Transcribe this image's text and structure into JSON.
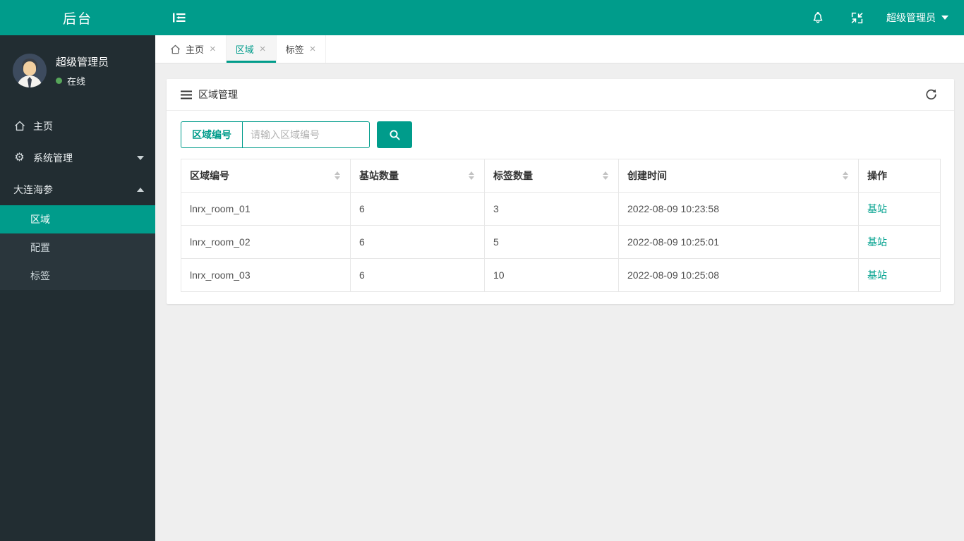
{
  "colors": {
    "accent": "#009c8b",
    "sidebar_bg": "#222d32",
    "submenu_bg": "#2a363c",
    "status_green": "#57a65a"
  },
  "header": {
    "logo": "后台",
    "user_menu_label": "超级管理员",
    "icons": [
      "sidebar-toggle",
      "notifications-bell",
      "exit-fullscreen",
      "user-caret"
    ]
  },
  "sidebar": {
    "user": {
      "name": "超级管理员",
      "status": "在线"
    },
    "menu": [
      {
        "label": "主页",
        "icon": "home"
      },
      {
        "label": "系统管理",
        "icon": "gear",
        "caret": "down"
      },
      {
        "label": "大连海参",
        "caret": "up",
        "expanded": true
      }
    ],
    "submenu": [
      {
        "label": "区域",
        "active": true
      },
      {
        "label": "配置",
        "active": false
      },
      {
        "label": "标签",
        "active": false
      }
    ]
  },
  "tabs": [
    {
      "label": "主页",
      "icon": "home",
      "active": false
    },
    {
      "label": "区域",
      "active": true
    },
    {
      "label": "标签",
      "active": false
    }
  ],
  "panel": {
    "title": "区域管理",
    "search": {
      "field_label": "区域编号",
      "placeholder": "请输入区域编号",
      "button_icon": "magnifier"
    },
    "refresh_icon": "refresh"
  },
  "table": {
    "columns": [
      {
        "label": "区域编号",
        "sortable": true
      },
      {
        "label": "基站数量",
        "sortable": true
      },
      {
        "label": "标签数量",
        "sortable": true
      },
      {
        "label": "创建时间",
        "sortable": true
      },
      {
        "label": "操作",
        "sortable": false
      }
    ],
    "rows": [
      {
        "area_id": "lnrx_room_01",
        "stations": "6",
        "tags": "3",
        "created": "2022-08-09 10:23:58",
        "action": "基站"
      },
      {
        "area_id": "lnrx_room_02",
        "stations": "6",
        "tags": "5",
        "created": "2022-08-09 10:25:01",
        "action": "基站"
      },
      {
        "area_id": "lnrx_room_03",
        "stations": "6",
        "tags": "10",
        "created": "2022-08-09 10:25:08",
        "action": "基站"
      }
    ]
  }
}
